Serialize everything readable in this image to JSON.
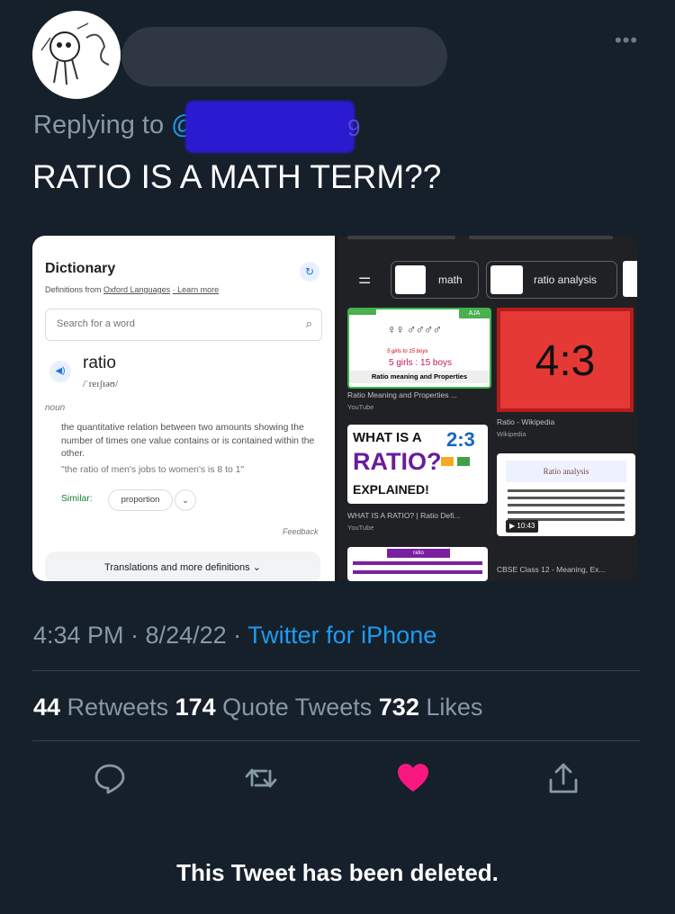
{
  "tweet": {
    "replying_prefix": "Replying to ",
    "replying_handle": "@",
    "handle_tail": "9",
    "text": "RATIO IS A MATH TERM??",
    "time": "4:34 PM · 8/24/22 · ",
    "source": "Twitter for iPhone",
    "deleted_notice": "This Tweet has been deleted."
  },
  "stats": {
    "retweets_count": "44",
    "retweets_label": " Retweets ",
    "quotes_count": "174",
    "quotes_label": " Quote Tweets ",
    "likes_count": "732",
    "likes_label": " Likes"
  },
  "dictionary": {
    "title": "Dictionary",
    "source_prefix": "Definitions from ",
    "source_name": "Oxford Languages",
    "learn_more": "· Learn more",
    "search_placeholder": "Search for a word",
    "word": "ratio",
    "pronunciation": "/ˈreɪʃɪəʊ/",
    "part_of_speech": "noun",
    "definition": "the quantitative relation between two amounts showing the number of times one value contains or is contained within the other.",
    "example": "\"the ratio of men's jobs to women's is 8 to 1\"",
    "similar_label": "Similar:",
    "similar_word": "proportion",
    "feedback": "Feedback",
    "translations": "Translations and more definitions"
  },
  "image_results": {
    "chip_1": "math",
    "chip_2": "ratio analysis",
    "card_1_tag": "AJA",
    "card_1_caption": "5 girls to 15 boys",
    "card_1_ratio": "5 girls : 15 boys",
    "card_1_banner": "Ratio meaning and Properties",
    "card_1_title": "Ratio Meaning and Properties ...",
    "card_1_source": "YouTube",
    "card_2_ratio": "4:3",
    "card_2_title": "Ratio - Wikipedia",
    "card_2_source": "Wikipedia",
    "card_3_line1": "WHAT IS A",
    "card_3_line2": "RATIO?",
    "card_3_ratio": "2:3",
    "card_3_line3": "EXPLAINED!",
    "card_3_title": "WHAT IS A RATIO? | Ratio Defi...",
    "card_3_source": "YouTube",
    "card_4_heading": "Ratio analysis",
    "card_4_duration": "10:43",
    "card_4_title": "CBSE Class 12 - Meaning, Ex...",
    "card_5_heading": "ratio"
  },
  "colors": {
    "background": "#15202b",
    "accent": "#1d9bf0",
    "like": "#f91880",
    "muted": "#8899a6"
  }
}
